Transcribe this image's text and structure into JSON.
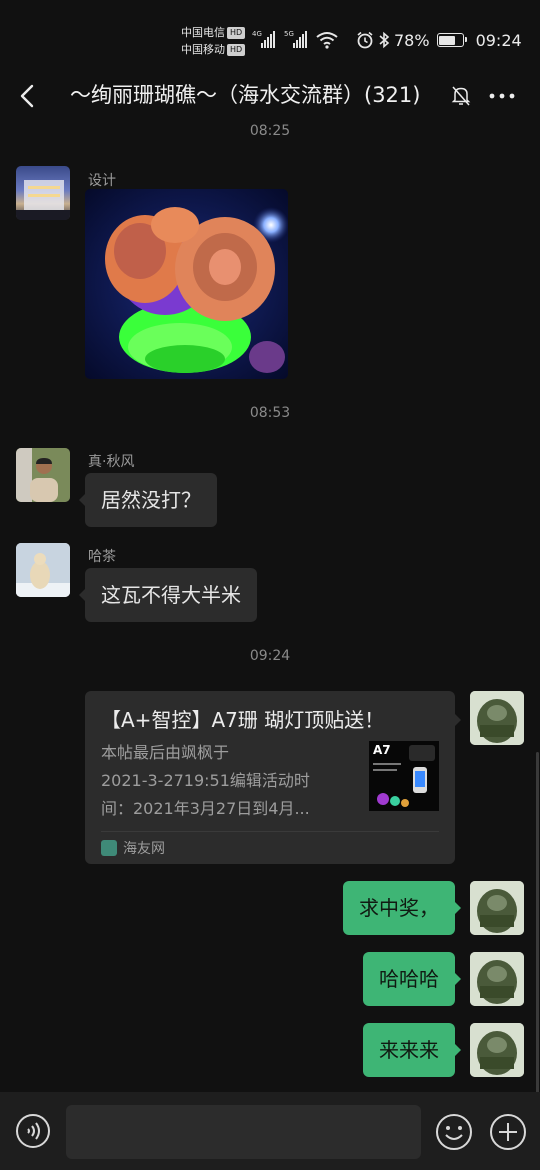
{
  "status_bar": {
    "carrier1": "中国电信",
    "carrier2": "中国移动",
    "hd_badge": "HD",
    "net1": "4G",
    "net2": "5G",
    "battery_text": "78%",
    "battery_level": 0.78,
    "time": "09:24"
  },
  "header": {
    "title": "～绚丽珊瑚礁～（海水交流群）(321)"
  },
  "messages": {
    "time1": "08:25",
    "sender1": "设计",
    "time2": "08:53",
    "sender2": "真·秋风",
    "msg2": "居然没打？",
    "sender3": "哈茶",
    "msg3": "这瓦不得大半米",
    "time3": "09:24",
    "card": {
      "title": "【A+智控】A7珊 瑚灯顶贴送！",
      "desc_line1": "本帖最后由飒枫于",
      "desc_line2": "2021-3-2719:51编辑活动时",
      "desc_line3": "间：2021年3月27日到4月...",
      "thumb_label": "A7",
      "source": "海友网"
    },
    "msg_r1": "求中奖，",
    "msg_r2": "哈哈哈",
    "msg_r3": "来来来"
  },
  "input": {
    "placeholder": ""
  },
  "icons": [
    "back-arrow-icon",
    "mute-bell-icon",
    "more-dots-icon",
    "alarm-icon",
    "bluetooth-icon",
    "wifi-icon",
    "voice-icon",
    "emoji-icon",
    "plus-icon"
  ]
}
